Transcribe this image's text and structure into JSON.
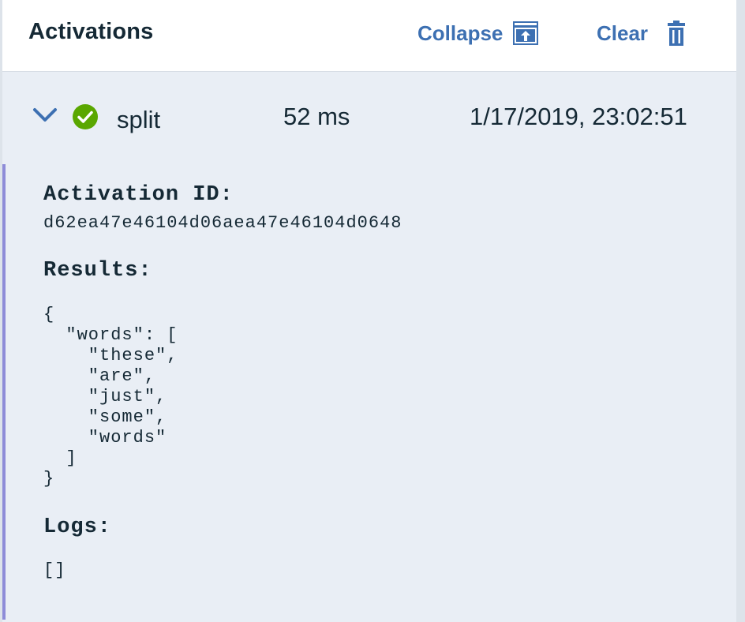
{
  "header": {
    "title": "Activations",
    "collapse_label": "Collapse",
    "clear_label": "Clear"
  },
  "activation": {
    "status": "success",
    "name": "split",
    "duration": "52 ms",
    "timestamp": "1/17/2019, 23:02:51",
    "id_label": "Activation ID:",
    "id": "d62ea47e46104d06aea47e46104d0648",
    "results_label": "Results:",
    "results": "{\n  \"words\": [\n    \"these\",\n    \"are\",\n    \"just\",\n    \"some\",\n    \"words\"\n  ]\n}",
    "logs_label": "Logs:",
    "logs": "[]"
  },
  "colors": {
    "accent": "#3d70b2",
    "success": "#5aa700",
    "detail_border": "#8e8cd8",
    "panel_bg": "#e9eef5"
  },
  "icons": {
    "collapse": "collapse-icon",
    "clear": "trash-icon",
    "expand": "chevron-down-icon",
    "status": "checkmark-circle-icon"
  }
}
